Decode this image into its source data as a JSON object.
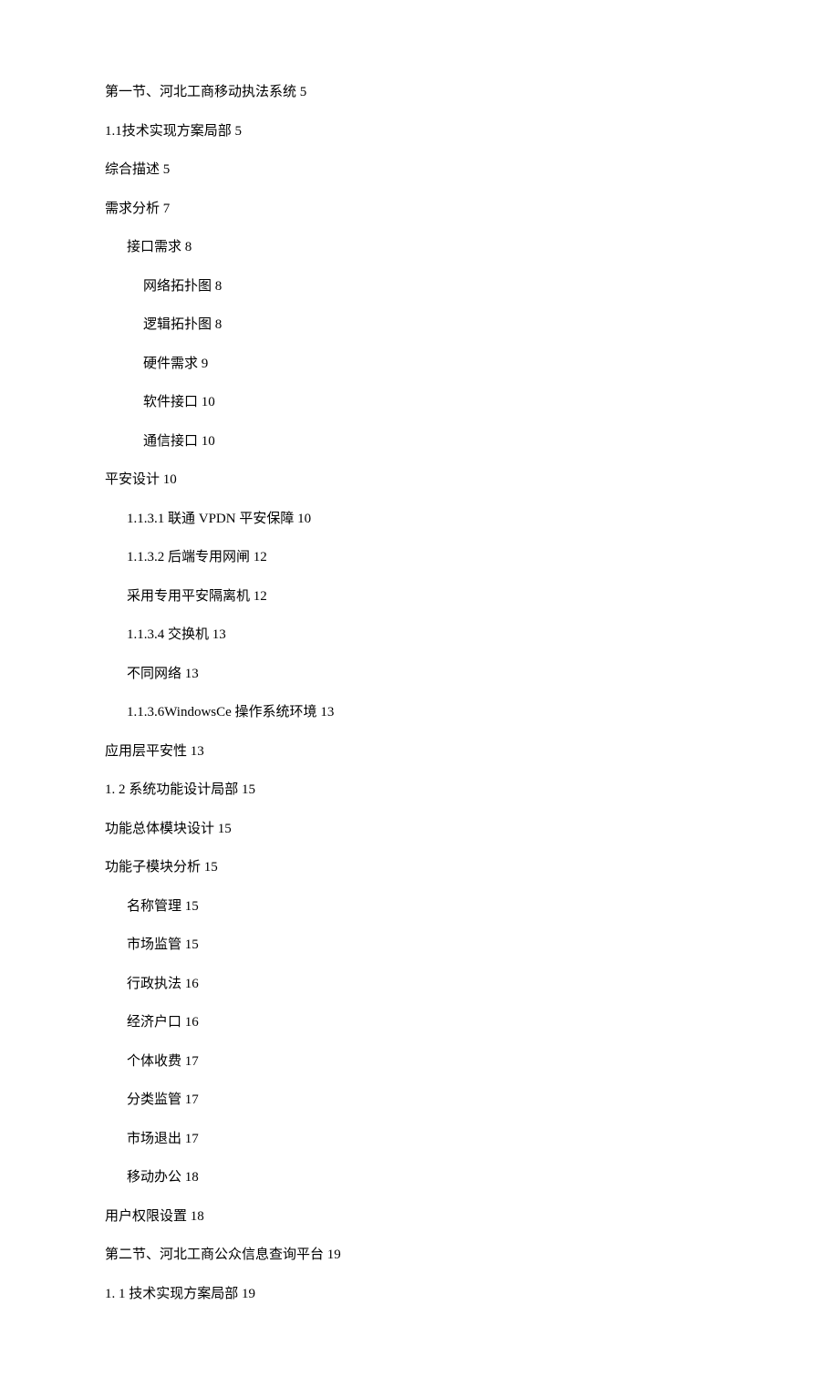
{
  "toc": [
    {
      "indent": 0,
      "title": "第一节、河北工商移动执法系统",
      "page": "5"
    },
    {
      "indent": 0,
      "title": "1.1技术实现方案局部",
      "page": "5"
    },
    {
      "indent": 0,
      "title": "综合描述",
      "page": "5"
    },
    {
      "indent": 0,
      "title": "需求分析",
      "page": "7"
    },
    {
      "indent": 1,
      "title": "接口需求",
      "page": "8"
    },
    {
      "indent": 2,
      "title": "网络拓扑图",
      "page": "8"
    },
    {
      "indent": 2,
      "title": "逻辑拓扑图",
      "page": "8"
    },
    {
      "indent": 2,
      "title": "硬件需求",
      "page": "9"
    },
    {
      "indent": 2,
      "title": "软件接口",
      "page": "10"
    },
    {
      "indent": 2,
      "title": "通信接口",
      "page": "10"
    },
    {
      "indent": 0,
      "title": "平安设计",
      "page": "10"
    },
    {
      "indent": 1,
      "title": "1.1.3.1 联通 VPDN 平安保障",
      "page": "10"
    },
    {
      "indent": 1,
      "title": "1.1.3.2 后端专用网闸",
      "page": "12"
    },
    {
      "indent": 1,
      "title": "采用专用平安隔离机",
      "page": "12"
    },
    {
      "indent": 1,
      "title": "1.1.3.4 交换机",
      "page": "13"
    },
    {
      "indent": 1,
      "title": "不同网络",
      "page": "13"
    },
    {
      "indent": 1,
      "title": "1.1.3.6WindowsCe 操作系统环境",
      "page": "13"
    },
    {
      "indent": 0,
      "title": "应用层平安性",
      "page": "13"
    },
    {
      "indent": 0,
      "title": "1. 2 系统功能设计局部",
      "page": "15"
    },
    {
      "indent": 0,
      "title": "功能总体模块设计",
      "page": "15"
    },
    {
      "indent": 0,
      "title": "功能子模块分析",
      "page": "15"
    },
    {
      "indent": 1,
      "title": "名称管理",
      "page": "15"
    },
    {
      "indent": 1,
      "title": "市场监管",
      "page": "15"
    },
    {
      "indent": 1,
      "title": "行政执法",
      "page": "16"
    },
    {
      "indent": 1,
      "title": "经济户口",
      "page": "16"
    },
    {
      "indent": 1,
      "title": "个体收费",
      "page": "17"
    },
    {
      "indent": 1,
      "title": "分类监管",
      "page": "17"
    },
    {
      "indent": 1,
      "title": "市场退出",
      "page": "17"
    },
    {
      "indent": 1,
      "title": "移动办公",
      "page": "18"
    },
    {
      "indent": 0,
      "title": "用户权限设置",
      "page": "18"
    },
    {
      "indent": 0,
      "title": "第二节、河北工商公众信息查询平台",
      "page": "19"
    },
    {
      "indent": 0,
      "title": "1. 1 技术实现方案局部",
      "page": "19"
    }
  ]
}
